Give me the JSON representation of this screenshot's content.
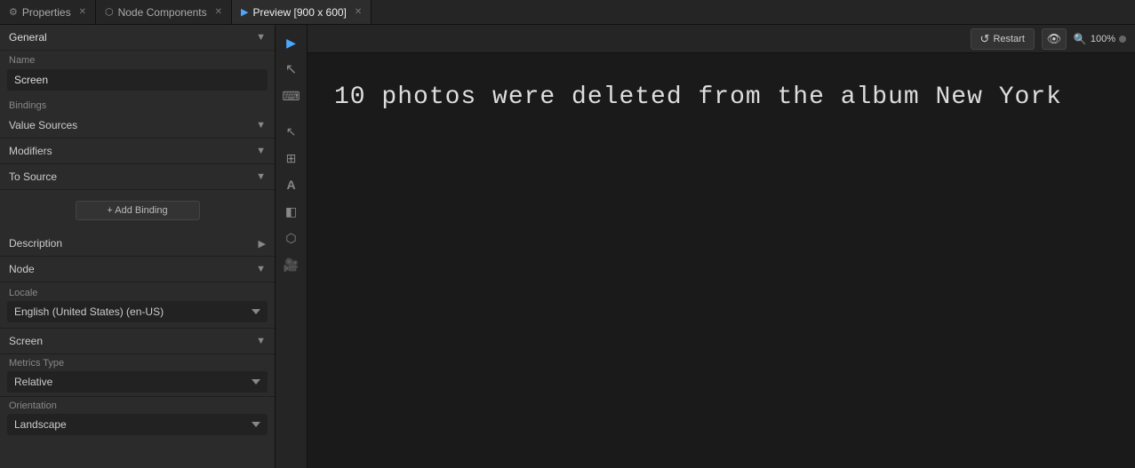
{
  "tabs": [
    {
      "id": "properties",
      "label": "Properties",
      "icon": "⚙",
      "active": false,
      "closable": true
    },
    {
      "id": "node-components",
      "label": "Node Components",
      "icon": "⬡",
      "active": false,
      "closable": true
    },
    {
      "id": "preview",
      "label": "Preview [900 x 600]",
      "icon": "▶",
      "active": true,
      "closable": true
    }
  ],
  "left_panel": {
    "general_section": {
      "title": "General",
      "expanded": true
    },
    "name_label": "Name",
    "name_value": "Screen",
    "bindings_label": "Bindings",
    "value_sources": {
      "label": "Value Sources",
      "expanded": true
    },
    "modifiers": {
      "label": "Modifiers",
      "expanded": true
    },
    "to_source": {
      "label": "To Source",
      "expanded": true
    },
    "add_binding_label": "+ Add Binding",
    "description": {
      "label": "Description",
      "has_arrow": true
    },
    "node": {
      "label": "Node",
      "expanded": true
    },
    "locale_label": "Locale",
    "locale_value": "English (United States) (en-US)",
    "screen_section": {
      "label": "Screen",
      "expanded": true
    },
    "metrics_type_label": "Metrics Type",
    "metrics_type_value": "Relative",
    "orientation_label": "Orientation",
    "orientation_value": "Landscape"
  },
  "toolbar": {
    "tools": [
      {
        "id": "cursor",
        "icon": "↖",
        "label": "Cursor Tool",
        "active": false
      },
      {
        "id": "select",
        "icon": "◻",
        "label": "Select Tool",
        "active": false
      },
      {
        "id": "text-tool",
        "icon": "A",
        "label": "Text Tool",
        "active": false
      },
      {
        "id": "layers",
        "icon": "◧",
        "label": "Layers",
        "active": false
      },
      {
        "id": "share",
        "icon": "⬡",
        "label": "Share",
        "active": false
      },
      {
        "id": "camera",
        "icon": "📷",
        "label": "Camera",
        "active": false
      }
    ]
  },
  "preview": {
    "restart_label": "Restart",
    "zoom_value": "100%",
    "content_text": "10 photos were deleted from the album New York"
  },
  "colors": {
    "accent": "#4da6ff",
    "background": "#1e1e1e",
    "panel": "#2b2b2b",
    "tab_bar": "#252525"
  }
}
